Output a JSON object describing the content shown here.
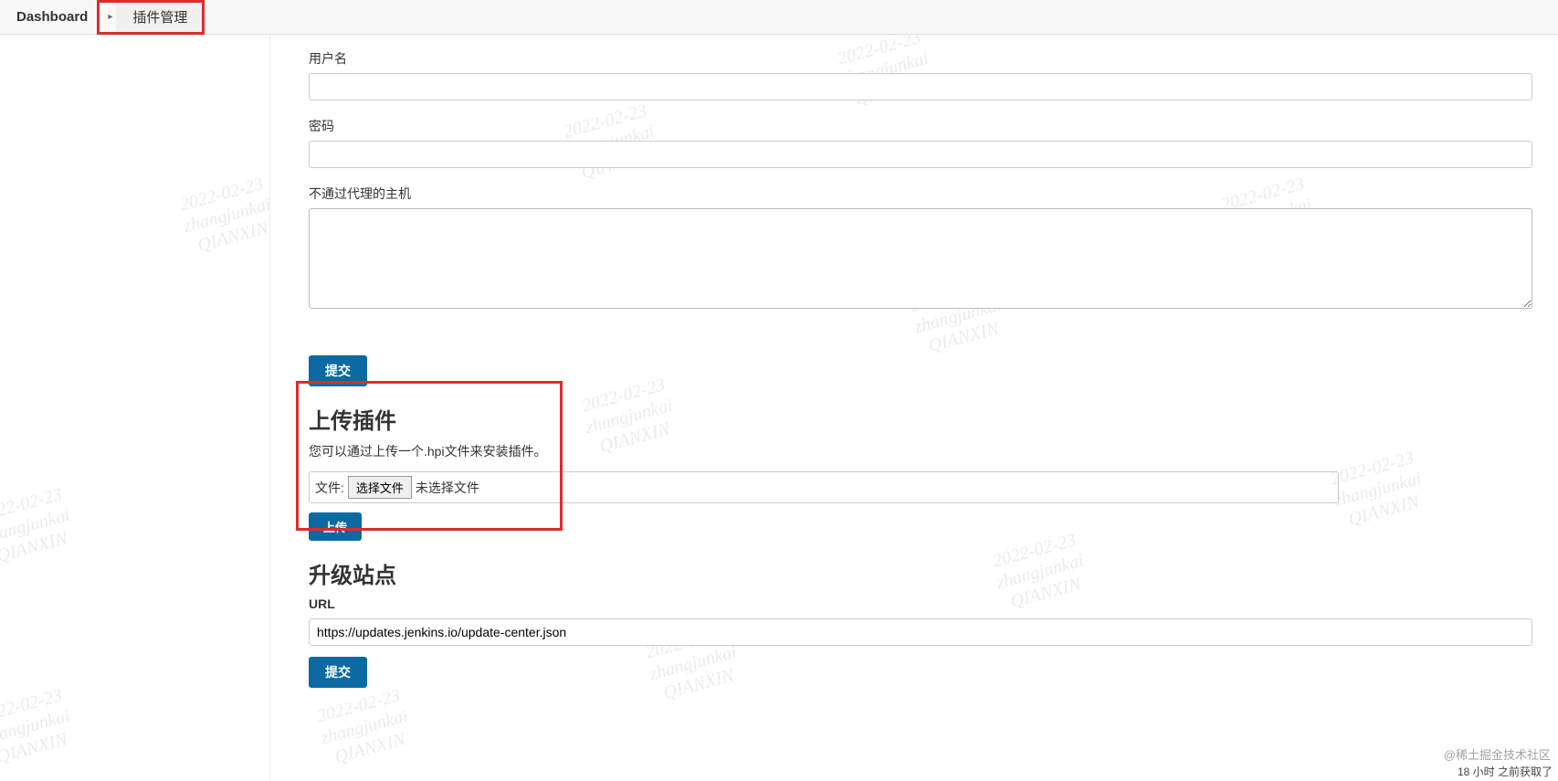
{
  "breadcrumb": {
    "dashboard": "Dashboard",
    "sep": "▸",
    "plugin_mgmt": "插件管理"
  },
  "watermark": {
    "line1": "2022-02-23",
    "line2": "zhangjunkai",
    "line3": "QIANXIN"
  },
  "form": {
    "username_label": "用户名",
    "username_value": "",
    "password_label": "密码",
    "password_value": "",
    "no_proxy_label": "不通过代理的主机",
    "no_proxy_value": "",
    "submit_label": "提交"
  },
  "upload": {
    "heading": "上传插件",
    "desc": "您可以通过上传一个.hpi文件来安装插件。",
    "file_label": "文件:",
    "choose_file": "选择文件",
    "no_file_selected": "未选择文件",
    "upload_btn": "上传"
  },
  "update_site": {
    "heading": "升级站点",
    "url_label": "URL",
    "url_value": "https://updates.jenkins.io/update-center.json",
    "submit_label": "提交"
  },
  "footer": {
    "credit": "@稀土掘金技术社区",
    "status": "18 小时 之前获取了"
  }
}
